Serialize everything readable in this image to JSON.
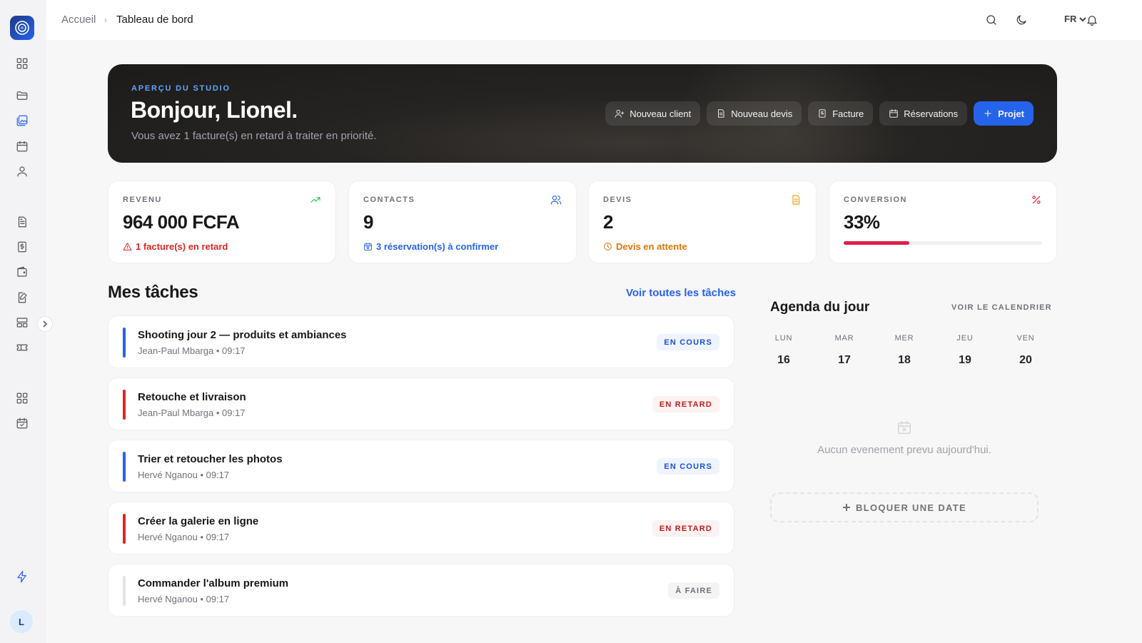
{
  "breadcrumb": {
    "home": "Accueil",
    "separator": "›",
    "current": "Tableau de bord"
  },
  "topbar": {
    "language": "FR"
  },
  "sidebar": {
    "avatar_initial": "L",
    "items": [
      "dashboard-icon",
      "folder-icon",
      "gallery-icon",
      "calendar-icon",
      "user-icon",
      "document-icon",
      "invoice-icon",
      "wallet-icon",
      "edit-document-icon",
      "layout-icon",
      "ticket-icon",
      "grid-icon",
      "calendar-check-icon",
      "bolt-icon"
    ]
  },
  "hero": {
    "eyebrow": "APERÇU DU STUDIO",
    "title": "Bonjour, Lionel.",
    "subtitle": "Vous avez 1 facture(s) en retard à traiter en priorité.",
    "actions": {
      "new_client": "Nouveau client",
      "new_quote": "Nouveau devis",
      "invoice": "Facture",
      "bookings": "Réservations",
      "project": "Projet"
    }
  },
  "kpis": {
    "revenue": {
      "label": "REVENU",
      "value": "964 000 FCFA",
      "note": "1 facture(s) en retard",
      "color": "#dc2626"
    },
    "contacts": {
      "label": "CONTACTS",
      "value": "9",
      "note": "3 réservation(s) à confirmer",
      "color": "#2563eb"
    },
    "quotes": {
      "label": "DEVIS",
      "value": "2",
      "note": "Devis en attente",
      "color": "#d97706"
    },
    "conversion": {
      "label": "CONVERSION",
      "value": "33%",
      "progress": 0.33,
      "color": "#e11d48"
    }
  },
  "tasks": {
    "title": "Mes tâches",
    "see_all": "Voir toutes les tâches",
    "items": [
      {
        "title": "Shooting jour 2 — produits et ambiances",
        "meta": "Jean-Paul Mbarga • 09:17",
        "status": "EN COURS"
      },
      {
        "title": "Retouche et livraison",
        "meta": "Jean-Paul Mbarga • 09:17",
        "status": "EN RETARD"
      },
      {
        "title": "Trier et retoucher les photos",
        "meta": "Hervé Nganou • 09:17",
        "status": "EN COURS"
      },
      {
        "title": "Créer la galerie en ligne",
        "meta": "Hervé Nganou • 09:17",
        "status": "EN RETARD"
      },
      {
        "title": "Commander l'album premium",
        "meta": "Hervé Nganou • 09:17",
        "status": "À FAIRE"
      }
    ]
  },
  "agenda": {
    "title": "Agenda du jour",
    "calendar_link": "VOIR LE CALENDRIER",
    "days": [
      {
        "name": "LUN",
        "num": "16"
      },
      {
        "name": "MAR",
        "num": "17"
      },
      {
        "name": "MER",
        "num": "18"
      },
      {
        "name": "JEU",
        "num": "19"
      },
      {
        "name": "VEN",
        "num": "20"
      }
    ],
    "empty": "Aucun evenement prevu aujourd'hui.",
    "block_date": "BLOQUER UNE DATE"
  },
  "colors": {
    "accent": "#2563eb",
    "in_progress": "#2563eb",
    "late": "#dc2626",
    "todo": "#a1a1aa"
  }
}
